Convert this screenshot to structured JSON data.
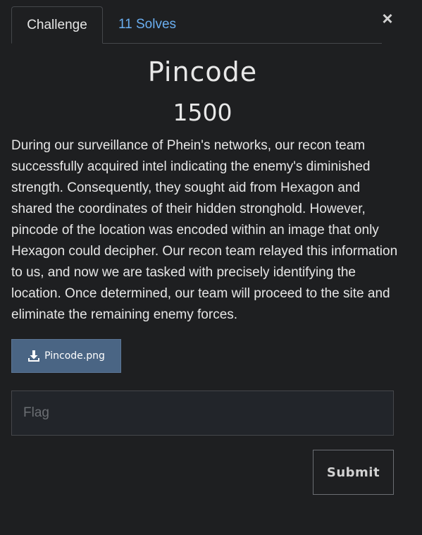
{
  "modal": {
    "close_label": "×",
    "close_icon": "close-icon"
  },
  "tabs": [
    {
      "label": "Challenge",
      "active": true
    },
    {
      "label": "11 Solves",
      "active": false
    }
  ],
  "challenge": {
    "name": "Pincode",
    "points": "1500",
    "description": "During our surveillance of Phein's networks, our recon team successfully acquired intel indicating the enemy's diminished strength. Consequently, they sought aid from Hexagon and shared the coordinates of their hidden stronghold. However, pincode of the location was encoded within an image that only Hexagon could decipher. Our recon team relayed this information to us, and now we are tasked with precisely identifying the location. Once determined, our team will proceed to the site and eliminate the remaining enemy forces.",
    "file": {
      "name": "Pincode.png",
      "icon": "download-icon"
    }
  },
  "flag_form": {
    "placeholder": "Flag",
    "value": "",
    "submit_label": "Submit"
  },
  "colors": {
    "background": "#1e1f21",
    "link": "#6aaef0",
    "file_button": "#4a6584",
    "border": "#45474b"
  }
}
